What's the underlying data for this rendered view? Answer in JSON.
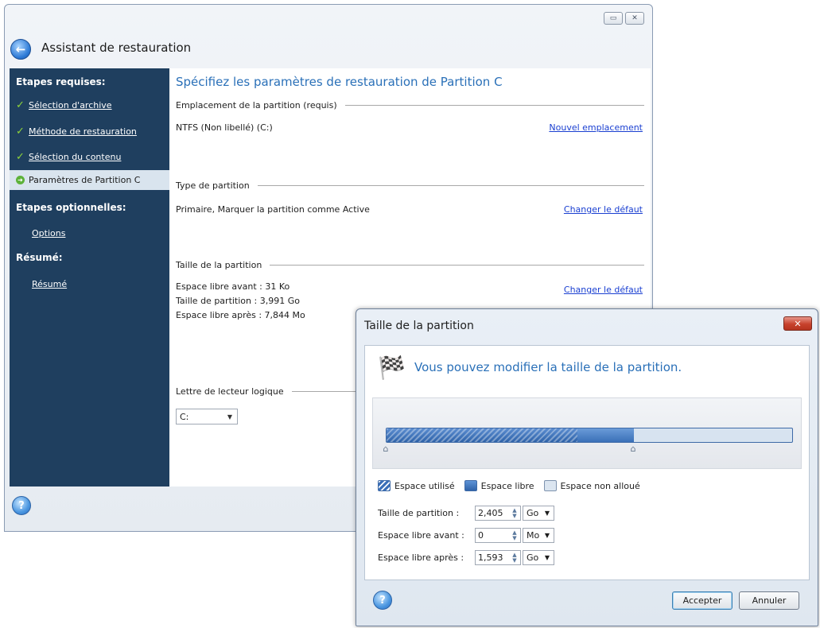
{
  "main_window": {
    "title": "Assistant de restauration",
    "sidebar": {
      "required_heading": "Etapes requises:",
      "steps": [
        {
          "label": "Sélection d'archive"
        },
        {
          "label": "Méthode de restauration"
        },
        {
          "label": "Sélection du contenu"
        }
      ],
      "current_step": "Paramètres de Partition C",
      "optional_heading": "Etapes optionnelles:",
      "options_link": "Options",
      "summary_heading": "Résumé:",
      "summary_link": "Résumé"
    },
    "content": {
      "title": "Spécifiez les paramètres de restauration de Partition C",
      "location_section": "Emplacement de la partition (requis)",
      "location_value": "NTFS (Non libellé) (C:)",
      "location_link": "Nouvel emplacement",
      "type_section": "Type de partition",
      "type_value": "Primaire, Marquer la partition comme Active",
      "type_link": "Changer le défaut",
      "size_section": "Taille de la partition",
      "free_before": "Espace libre avant : 31 Ko",
      "partition_size": "Taille de partition : 3,991 Go",
      "free_after": "Espace libre après : 7,844 Mo",
      "size_link": "Changer le défaut",
      "drive_section": "Lettre de lecteur logique",
      "drive_letter": "C:"
    }
  },
  "dialog": {
    "title": "Taille de la partition",
    "heading": "Vous pouvez modifier la taille de la partition.",
    "bar": {
      "used_fraction": 0.47,
      "partition_fraction": 0.61
    },
    "legend": {
      "used": "Espace utilisé",
      "free": "Espace libre",
      "unallocated": "Espace non alloué"
    },
    "fields": [
      {
        "label": "Taille de partition :",
        "value": "2,405",
        "unit": "Go"
      },
      {
        "label": "Espace libre avant :",
        "value": "0",
        "unit": "Mo"
      },
      {
        "label": "Espace libre après :",
        "value": "1,593",
        "unit": "Go"
      }
    ],
    "accept_label": "Accepter",
    "cancel_label": "Annuler"
  }
}
